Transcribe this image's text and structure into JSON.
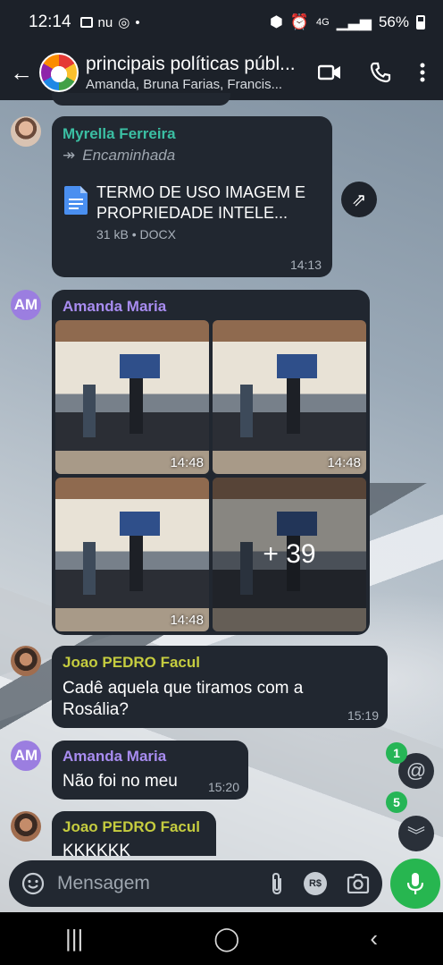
{
  "status": {
    "time": "12:14",
    "network": "4G",
    "battery": "56%"
  },
  "header": {
    "title": "principais políticas públ...",
    "subtitle": "Amanda, Bruna Farias, Francis..."
  },
  "messages": {
    "m1": {
      "sender": "Myrella Ferreira",
      "sender_color": "#3bbfa3",
      "forwarded_label": "Encaminhada",
      "file_name": "TERMO DE USO IMAGEM E PROPRIEDADE INTELE...",
      "file_meta": "31 kB • DOCX",
      "time": "14:13"
    },
    "m2": {
      "avatar_initials": "AM",
      "sender": "Amanda Maria",
      "sender_color": "#a88cf0",
      "photos": [
        {
          "time": "14:48"
        },
        {
          "time": "14:48"
        },
        {
          "time": "14:48"
        },
        {
          "more": "+ 39"
        }
      ]
    },
    "m3": {
      "sender": "Joao PEDRO Facul",
      "sender_color": "#c5cc3f",
      "text": "Cadê aquela que tiramos com a Rosália?",
      "time": "15:19"
    },
    "m4": {
      "avatar_initials": "AM",
      "sender": "Amanda Maria",
      "sender_color": "#a88cf0",
      "text": "Não foi no meu",
      "time": "15:20"
    },
    "m5": {
      "sender": "Joao PEDRO Facul",
      "sender_color": "#c5cc3f",
      "text": "KKKKKK"
    }
  },
  "floating": {
    "mention_count": "1",
    "unread_count": "5"
  },
  "composer": {
    "placeholder": "Mensagem",
    "rs_label": "R$"
  }
}
